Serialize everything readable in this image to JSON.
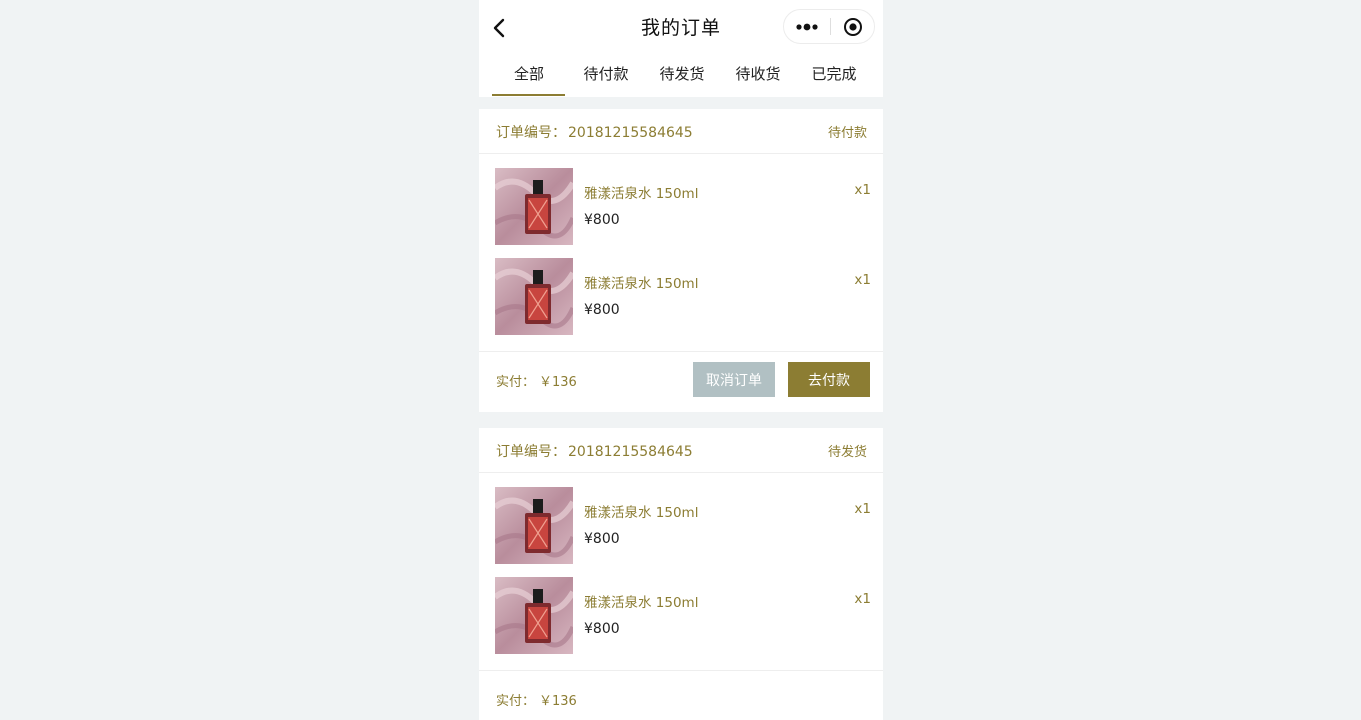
{
  "nav": {
    "title": "我的订单"
  },
  "tabs": [
    {
      "label": "全部"
    },
    {
      "label": "待付款"
    },
    {
      "label": "待发货"
    },
    {
      "label": "待收货"
    },
    {
      "label": "已完成"
    }
  ],
  "active_tab": "全部",
  "orders": [
    {
      "order_no_label": "订单编号：",
      "order_no": "20181215584645",
      "status": "待付款",
      "items": [
        {
          "name": "雅漾活泉水 150ml",
          "qty": "x1",
          "price": "¥800"
        },
        {
          "name": "雅漾活泉水 150ml",
          "qty": "x1",
          "price": "¥800"
        }
      ],
      "paid_label": "实付：",
      "paid_amount": "￥136",
      "cancel_label": "取消订单",
      "pay_label": "去付款"
    },
    {
      "order_no_label": "订单编号：",
      "order_no": "20181215584645",
      "status": "待发货",
      "items": [
        {
          "name": "雅漾活泉水 150ml",
          "qty": "x1",
          "price": "¥800"
        },
        {
          "name": "雅漾活泉水 150ml",
          "qty": "x1",
          "price": "¥800"
        }
      ],
      "paid_label": "实付：",
      "paid_amount": "￥136"
    }
  ],
  "colors": {
    "accent": "#8c7d33",
    "cancel_button": "#b1c0c3",
    "page_bg": "#f0f3f4"
  },
  "icons": {
    "back": "back-arrow-icon",
    "more": "more-dots-icon",
    "close": "target-close-icon"
  }
}
